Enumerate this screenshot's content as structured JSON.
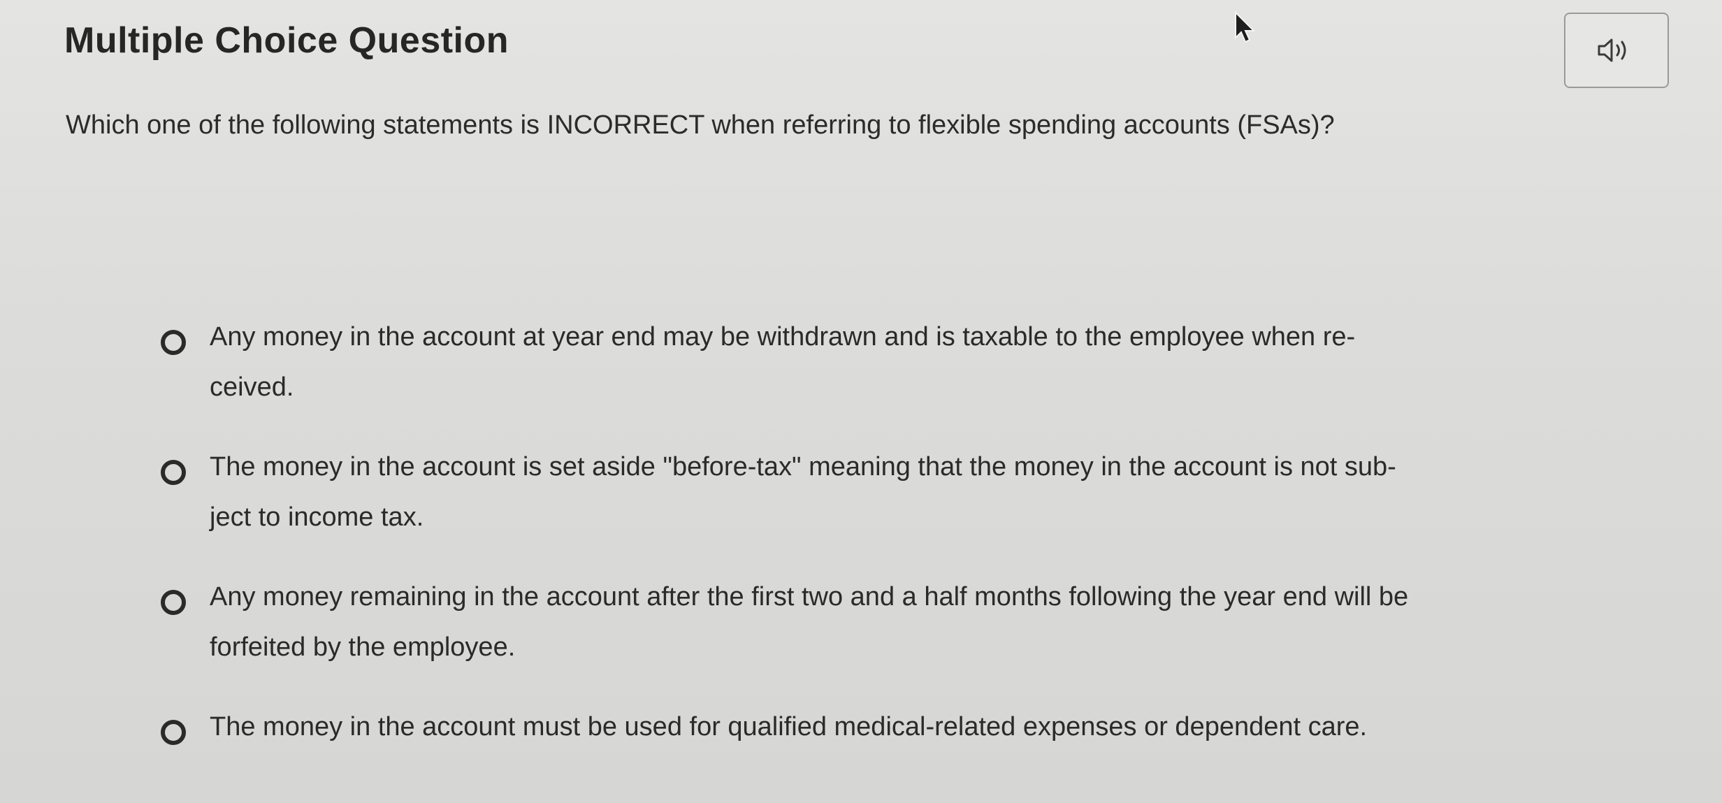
{
  "question": {
    "header": "Multiple Choice Question",
    "stem": "Which one of the following statements is INCORRECT when referring to flexible spending accounts (FSAs)?"
  },
  "audio_button": {
    "icon": "speaker-icon"
  },
  "choices": [
    {
      "line1": "Any money in the account at year end may be withdrawn and is taxable to the employee when re-",
      "line2": "ceived."
    },
    {
      "line1": "The money in the account is set aside \"before-tax\" meaning that the money in the account is not sub-",
      "line2": "ject to income tax."
    },
    {
      "line1": "Any money remaining in the account after the first two and a half months following the year end will be",
      "line2": "forfeited by the employee."
    },
    {
      "line1": "The money in the account must be used for qualified medical-related expenses or dependent care.",
      "line2": ""
    }
  ]
}
